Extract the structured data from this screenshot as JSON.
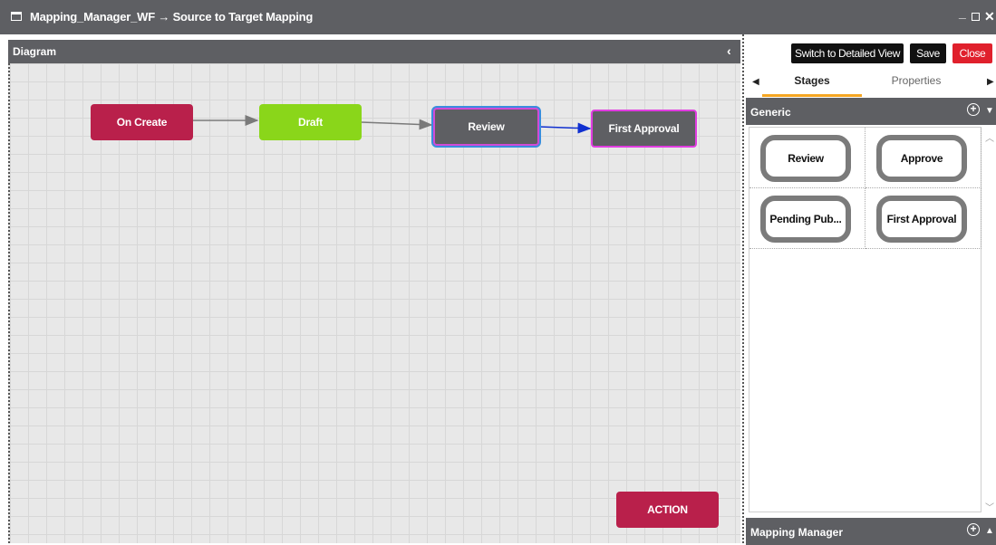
{
  "window": {
    "title": "Mapping_Manager_WF → Source to Target Mapping",
    "controls": {
      "minimize": "_",
      "close": "✕"
    }
  },
  "diagram": {
    "header": "Diagram",
    "collapse_icon": "chevron-left-icon",
    "nodes": [
      {
        "label": "On Create",
        "color": "#b9204b"
      },
      {
        "label": "Draft",
        "color": "#8ad61a"
      },
      {
        "label": "Review",
        "color": "#5e5f63"
      },
      {
        "label": "First Approval",
        "color": "#5e5f63"
      }
    ],
    "action_label": "ACTION"
  },
  "toolbar": {
    "switch_label": "Switch to Detailed View",
    "save_label": "Save",
    "close_label": "Close"
  },
  "tabs": {
    "stages": "Stages",
    "properties": "Properties"
  },
  "generic": {
    "header": "Generic",
    "stages": [
      "Review",
      "Approve",
      "Pending Pub...",
      "First Approval"
    ]
  },
  "mapping_manager": {
    "header": "Mapping Manager"
  },
  "colors": {
    "accent": "#f5a623",
    "header_bg": "#5e5f63",
    "close_red": "#e0202c"
  }
}
